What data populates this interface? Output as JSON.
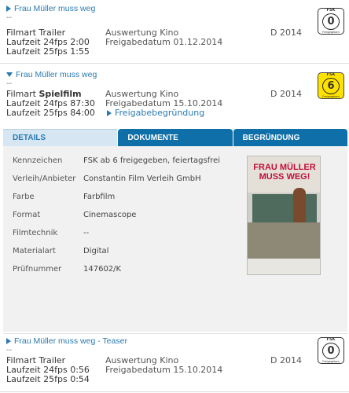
{
  "entries": {
    "first": {
      "title": "Frau Müller muss weg",
      "dashes": "--",
      "col1": [
        "Filmart Trailer",
        "Laufzeit 24fps 2:00",
        "Laufzeit 25fps 1:55"
      ],
      "col2": [
        "Auswertung Kino",
        "Freigabedatum 01.12.2014"
      ],
      "year": "D 2014",
      "fsk": {
        "label": "FSK",
        "number": "0",
        "sub": "Freigegeben"
      }
    },
    "second": {
      "title": "Frau Müller muss weg",
      "dashes": "--",
      "filmart_label": "Filmart ",
      "filmart_value": "Spielfilm",
      "col1": [
        "Laufzeit 24fps 87:30",
        "Laufzeit 25fps 84:00"
      ],
      "col2": [
        "Auswertung Kino",
        "Freigabedatum 15.10.2014"
      ],
      "link": "Freigabebegründung",
      "year": "D 2014",
      "fsk": {
        "label": "FSK",
        "number": "6",
        "sub": "Freigegeben"
      }
    },
    "third": {
      "title": "Frau Müller muss weg - Teaser",
      "dashes": "--",
      "col1": [
        "Filmart Trailer",
        "Laufzeit 24fps 0:56",
        "Laufzeit 25fps 0:54"
      ],
      "col2": [
        "Auswertung Kino",
        "Freigabedatum 15.10.2014"
      ],
      "year": "D 2014",
      "fsk": {
        "label": "FSK",
        "number": "0",
        "sub": "Freigegeben"
      }
    }
  },
  "tabs": [
    "DETAILS",
    "DOKUMENTE",
    "BEGRÜNDUNG"
  ],
  "details": [
    {
      "key": "Kennzeichen",
      "value": "FSK ab 6 freigegeben, feiertagsfrei"
    },
    {
      "key": "Verleih/Anbieter",
      "value": "Constantin Film Verleih GmbH"
    },
    {
      "key": "Farbe",
      "value": "Farbfilm"
    },
    {
      "key": "Format",
      "value": "Cinemascope"
    },
    {
      "key": "Filmtechnik",
      "value": "--"
    },
    {
      "key": "Materialart",
      "value": "Digital"
    },
    {
      "key": "Prüfnummer",
      "value": "147602/K"
    }
  ],
  "poster": {
    "title": "FRAU MÜLLER MUSS WEG!"
  },
  "colors": {
    "link": "#2a7ab0",
    "tab_active_bg": "#d6e6f2",
    "tab_inactive_bg": "#0f6fa8",
    "fsk6": "#ffe200"
  },
  "icons": {
    "expand": "triangle-right-icon",
    "collapse": "triangle-down-icon"
  }
}
